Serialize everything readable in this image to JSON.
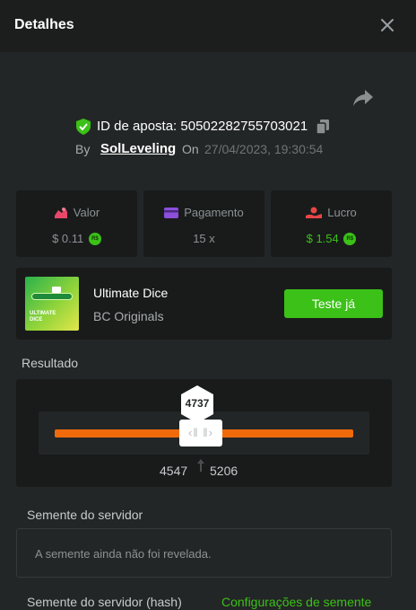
{
  "header": {
    "title": "Detalhes"
  },
  "bet": {
    "id_label": "ID de aposta: 50502282755703021",
    "by_label": "By",
    "user": "SolLeveling",
    "on_label": "On",
    "datetime": "27/04/2023, 19:30:54"
  },
  "stats": [
    {
      "label": "Valor",
      "value": "$ 0.11",
      "coin": "R$",
      "icon": "bet-amount-icon"
    },
    {
      "label": "Pagamento",
      "value": "15 x",
      "icon": "card-icon"
    },
    {
      "label": "Lucro",
      "value": "$ 1.54",
      "coin": "R$",
      "icon": "profit-icon"
    }
  ],
  "game": {
    "name": "Ultimate Dice",
    "provider": "BC Originals",
    "play_label": "Teste já",
    "thumb_text": "ULTIMATE\nDICE"
  },
  "result": {
    "title": "Resultado",
    "value": "4737",
    "range_low": "4547",
    "range_high": "5206"
  },
  "seed": {
    "server_title": "Semente do servidor",
    "server_value": "A semente ainda não foi revelada.",
    "hash_title": "Semente do servidor (hash)",
    "config_link": "Configurações de semente"
  },
  "colors": {
    "accent_green": "#3bc117",
    "track_orange": "#f06a0c",
    "valor_icon": "#e8476a",
    "pagamento_icon": "#8b4fdc",
    "lucro_icon": "#e84646"
  }
}
